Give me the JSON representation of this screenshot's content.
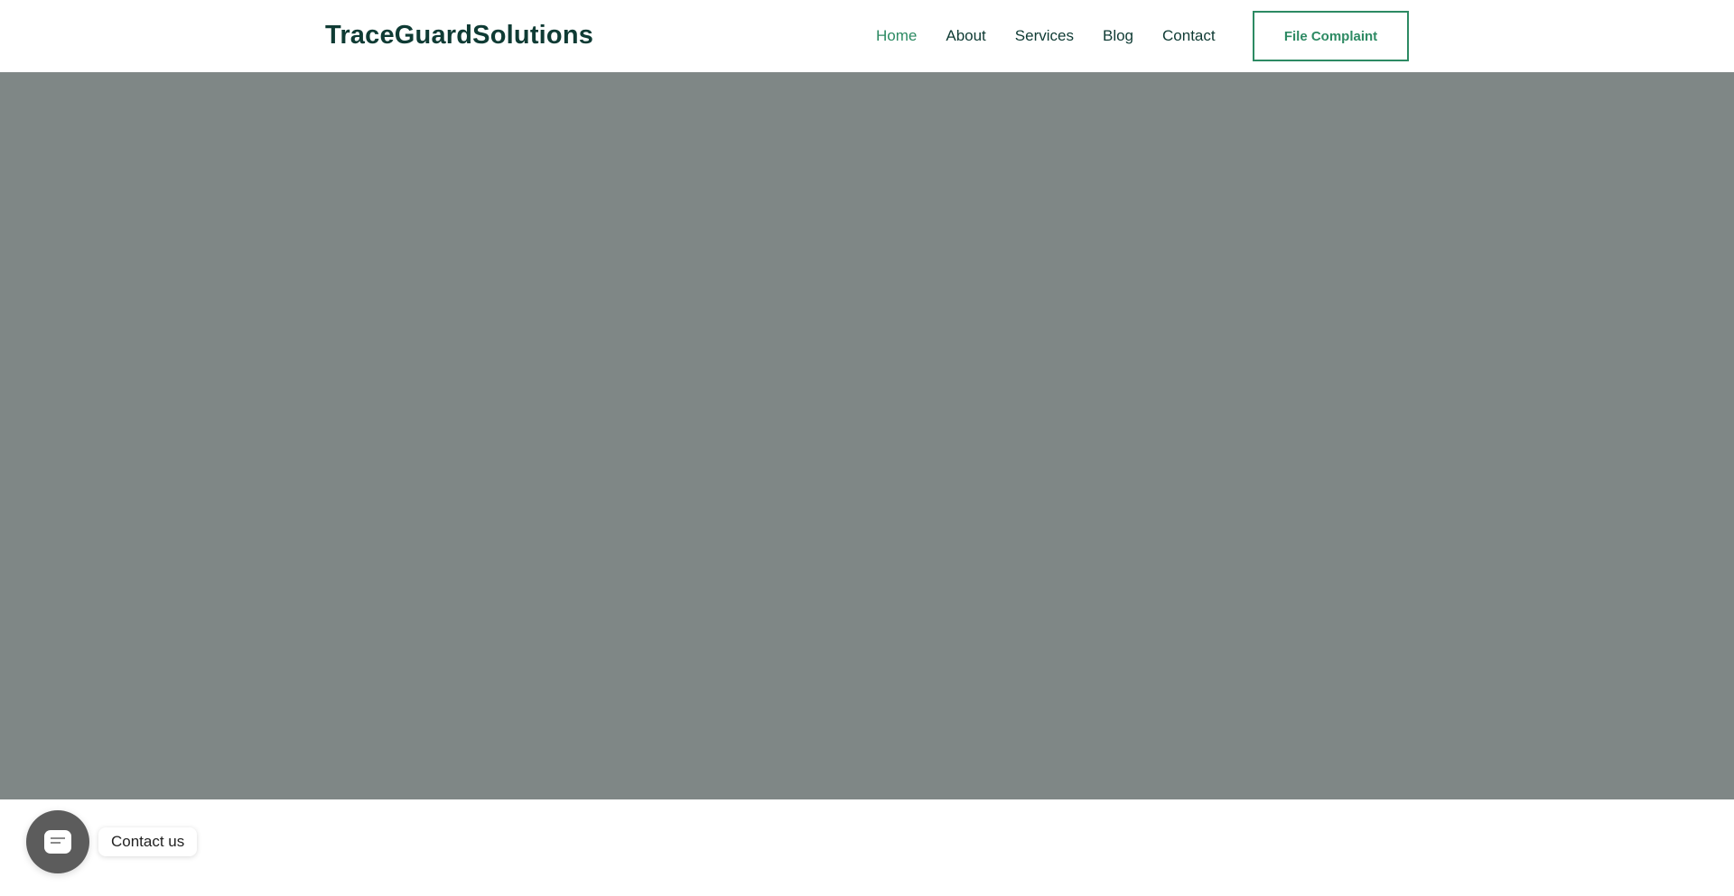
{
  "header": {
    "logo": "TraceGuardSolutions",
    "nav": [
      {
        "label": "Home",
        "active": true
      },
      {
        "label": "About",
        "active": false
      },
      {
        "label": "Services",
        "active": false
      },
      {
        "label": "Blog",
        "active": false
      },
      {
        "label": "Contact",
        "active": false
      }
    ],
    "cta_label": "File Complaint"
  },
  "hero": {
    "background_color": "#7f8786"
  },
  "contact_widget": {
    "label": "Contact us",
    "icon": "chat-bubble-icon"
  },
  "colors": {
    "brand_dark": "#0f3b34",
    "accent_green": "#2d8a63"
  }
}
